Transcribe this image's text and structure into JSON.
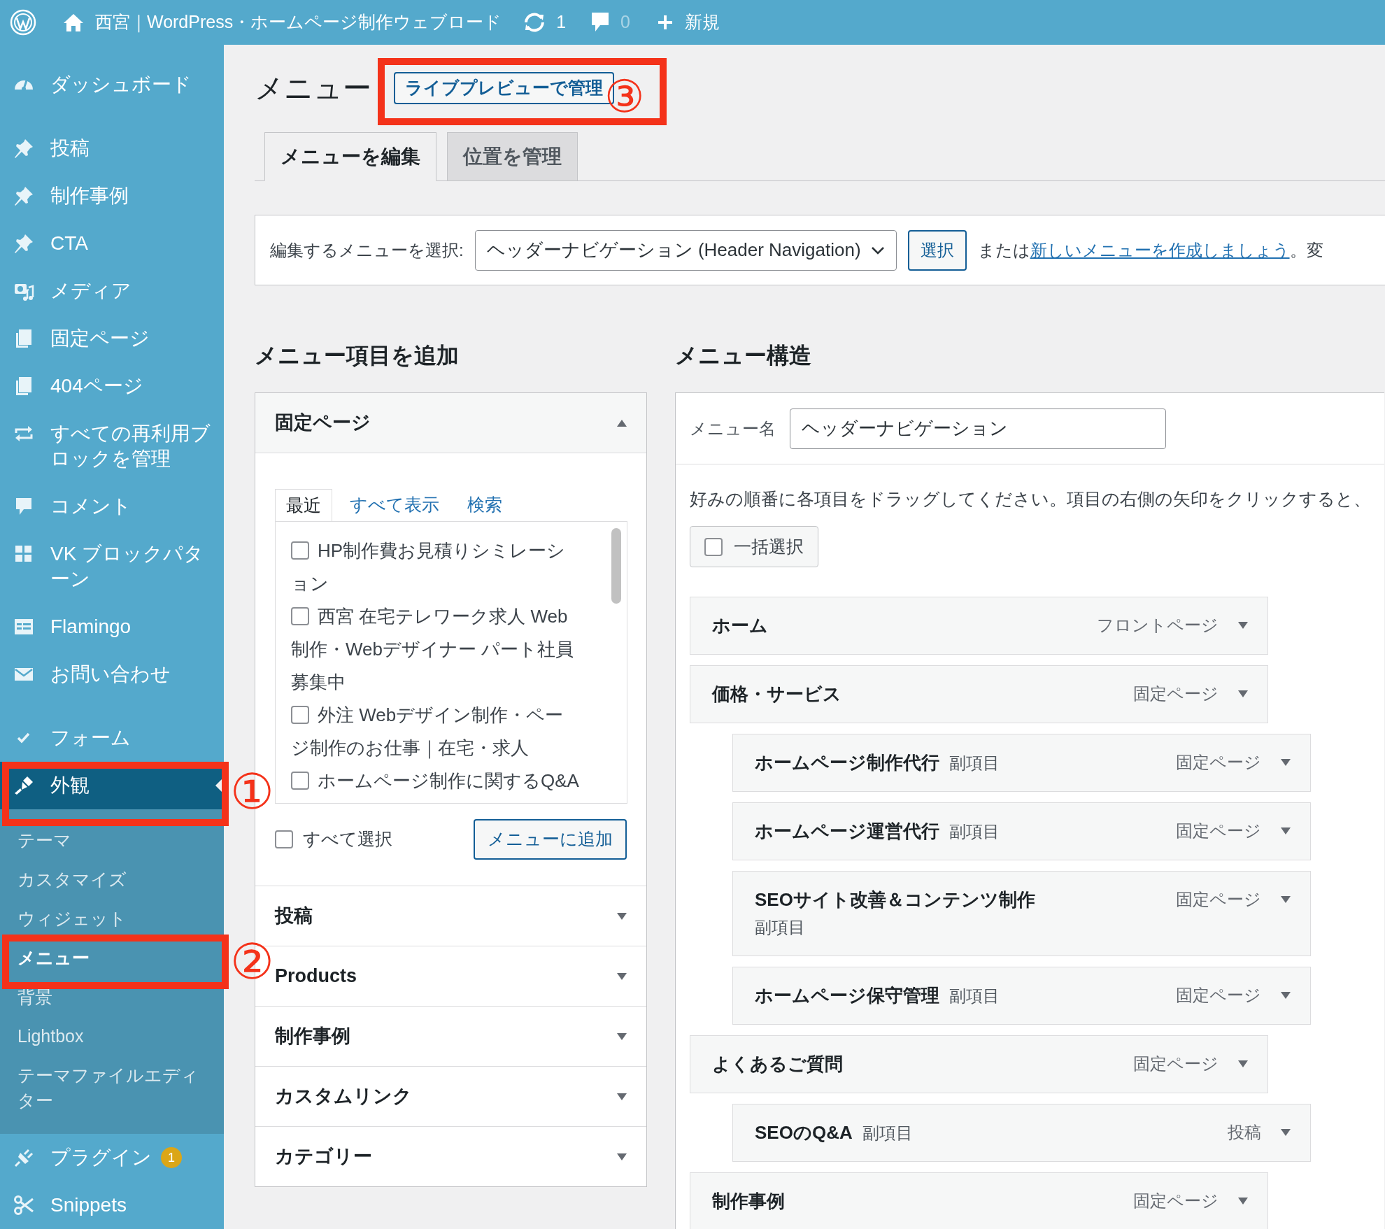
{
  "top_bar": {
    "site_name": "西宮｜WordPress・ホームページ制作ウェブロード",
    "updates": "1",
    "comments": "0",
    "new_label": "新規"
  },
  "sidebar": {
    "groups": [
      [
        {
          "label": "ダッシュボード",
          "selected": false
        }
      ],
      [
        {
          "label": "投稿",
          "selected": false
        },
        {
          "label": "制作事例",
          "selected": false
        },
        {
          "label": "CTA",
          "selected": false
        },
        {
          "label": "メディア",
          "selected": false
        },
        {
          "label": "固定ページ",
          "selected": false
        },
        {
          "label": "404ページ",
          "selected": false
        },
        {
          "label": "すべての再利用ブロックを管理",
          "selected": false
        },
        {
          "label": "コメント",
          "selected": false
        },
        {
          "label": "VK ブロックパターン",
          "selected": false
        },
        {
          "label": "Flamingo",
          "selected": false
        },
        {
          "label": "お問い合わせ",
          "selected": false
        }
      ],
      [
        {
          "label": "フォーム",
          "selected": false
        },
        {
          "label": "外観",
          "selected": true,
          "submenu": [
            {
              "label": "テーマ",
              "selected": false
            },
            {
              "label": "カスタマイズ",
              "selected": false
            },
            {
              "label": "ウィジェット",
              "selected": false
            },
            {
              "label": "メニュー",
              "selected": true
            },
            {
              "label": "背景",
              "selected": false
            },
            {
              "label": "Lightbox",
              "selected": false
            },
            {
              "label": "テーマファイルエディター",
              "selected": false
            }
          ]
        },
        {
          "label": "プラグイン",
          "selected": false,
          "badge": "1"
        },
        {
          "label": "Snippets",
          "selected": false
        }
      ]
    ]
  },
  "page": {
    "title": "メニュー",
    "live_preview_button": "ライブプレビューで管理"
  },
  "tabs": [
    {
      "label": "メニューを編集",
      "selected": true
    },
    {
      "label": "位置を管理",
      "selected": false
    }
  ],
  "menu_select": {
    "label": "編集するメニューを選択:",
    "value": "ヘッダーナビゲーション (Header Navigation)",
    "button": "選択",
    "hint_prefix": "または",
    "hint_link": "新しいメニューを作成しましょう",
    "hint_suffix": "。変"
  },
  "add_items": {
    "heading": "メニュー項目を追加",
    "sections": [
      {
        "title": "固定ページ",
        "expanded": true,
        "tabs": [
          {
            "label": "最近",
            "selected": true
          },
          {
            "label": "すべて表示",
            "selected": false
          },
          {
            "label": "検索",
            "selected": false
          }
        ],
        "items": [
          {
            "label": "HP制作費お見積りシミレーション",
            "checked": false
          },
          {
            "label": "西宮 在宅テレワーク求人 Web制作・Webデザイナー パート社員募集中",
            "checked": false
          },
          {
            "label": "外注 Webデザイン制作・ページ制作のお仕事｜在宅・求人",
            "checked": false
          },
          {
            "label": "ホームページ制作に関するQ&A",
            "checked": false
          }
        ],
        "select_all": {
          "label": "すべて選択",
          "checked": false
        },
        "add_button": "メニューに追加"
      },
      {
        "title": "投稿",
        "expanded": false
      },
      {
        "title": "Products",
        "expanded": false
      },
      {
        "title": "制作事例",
        "expanded": false
      },
      {
        "title": "カスタムリンク",
        "expanded": false
      },
      {
        "title": "カテゴリー",
        "expanded": false
      }
    ]
  },
  "structure": {
    "heading": "メニュー構造",
    "name_label": "メニュー名",
    "name_value": "ヘッダーナビゲーション",
    "instructions": "好みの順番に各項目をドラッグしてください。項目の右側の矢印をクリックすると、",
    "bulk_select": {
      "label": "一括選択",
      "checked": false
    },
    "items": [
      {
        "title": "ホーム",
        "type": "フロントページ"
      },
      {
        "title": "価格・サービス",
        "type": "固定ページ",
        "children": [
          {
            "title": "ホームページ制作代行",
            "sub_label": "副項目",
            "type": "固定ページ"
          },
          {
            "title": "ホームページ運営代行",
            "sub_label": "副項目",
            "type": "固定ページ"
          },
          {
            "title": "SEOサイト改善＆コンテンツ制作",
            "sub_label": "副項目",
            "type": "固定ページ"
          },
          {
            "title": "ホームページ保守管理",
            "sub_label": "副項目",
            "type": "固定ページ"
          }
        ]
      },
      {
        "title": "よくあるご質問",
        "type": "固定ページ",
        "children": [
          {
            "title": "SEOのQ&A",
            "sub_label": "副項目",
            "type": "投稿"
          }
        ]
      },
      {
        "title": "制作事例",
        "type": "固定ページ"
      }
    ]
  },
  "annotations": [
    {
      "label": "③"
    },
    {
      "label": "①"
    },
    {
      "label": "②"
    }
  ]
}
